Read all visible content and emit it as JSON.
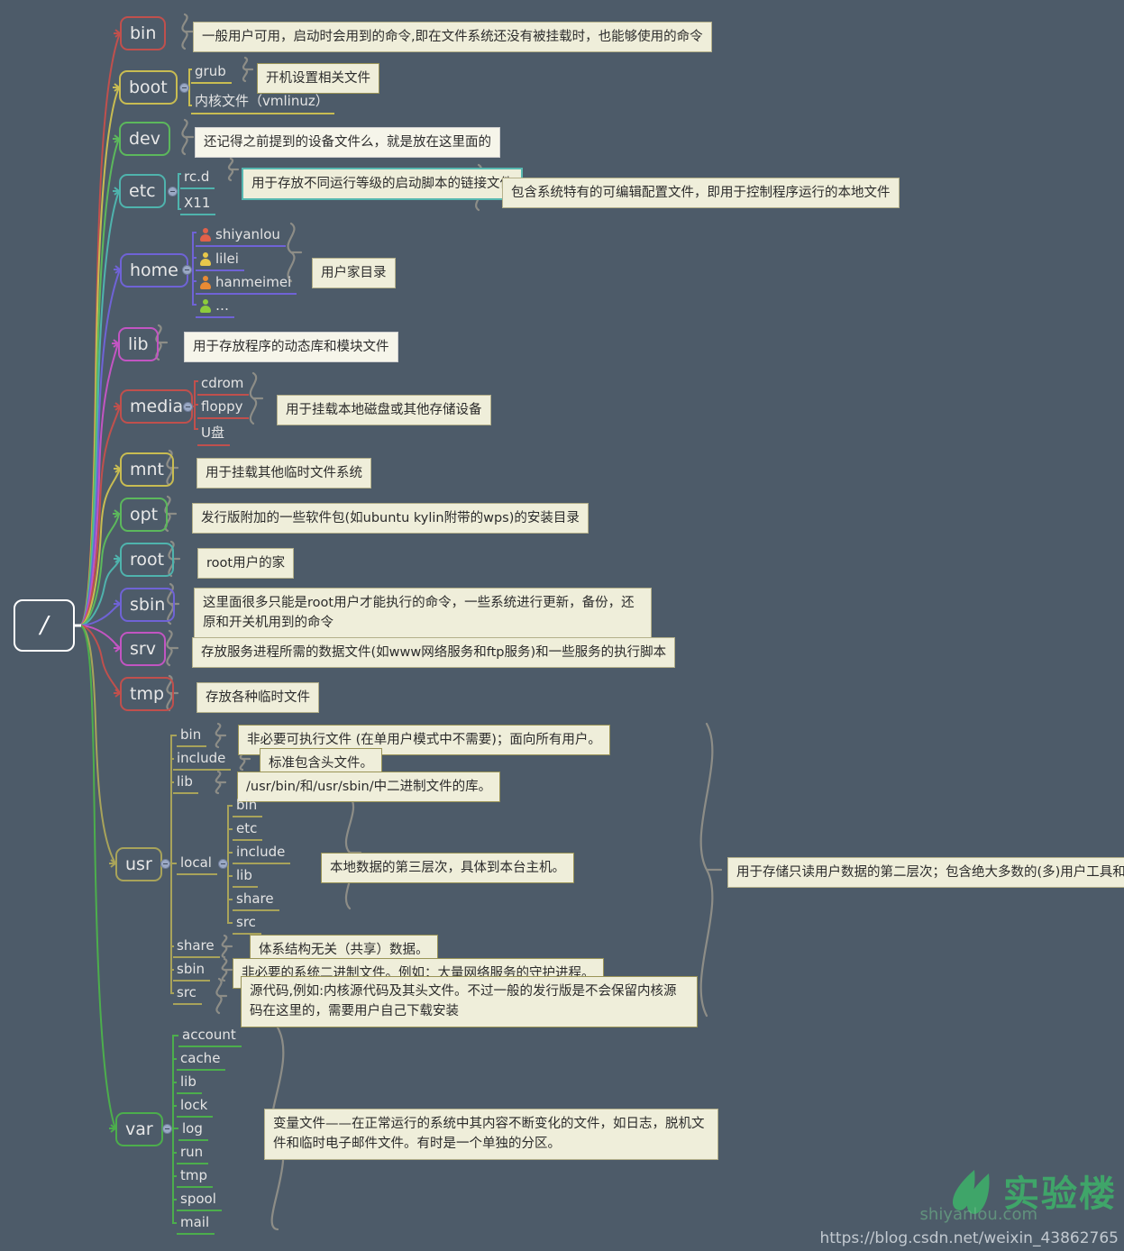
{
  "root": {
    "label": "/"
  },
  "watermark": {
    "brand": "实验楼",
    "sub": "shiyanlou.com",
    "blog_url": "https://blog.csdn.net/weixin_43862765"
  },
  "colors": {
    "background": "#4d5b69",
    "note_bg": "#efeeda",
    "root_border": "#ffffff",
    "bin": "#c0504d",
    "boot": "#c8bc52",
    "dev": "#5cb85c",
    "etc": "#4fb3ad",
    "home": "#6f63d6",
    "lib": "#c255c2",
    "media": "#c0504d",
    "mnt": "#c8bc52",
    "opt": "#5cb85c",
    "root_dir": "#4fb3ad",
    "sbin": "#6f63d6",
    "srv": "#c255c2",
    "tmp": "#c0504d",
    "usr": "#a8a35a",
    "var": "#4cae4c"
  },
  "nodes": [
    {
      "id": "bin",
      "label": "bin",
      "color": "#c0504d",
      "note": "一般用户可用，启动时会用到的命令,即在文件系统还没有被挂载时，也能够使用的命令",
      "children": []
    },
    {
      "id": "boot",
      "label": "boot",
      "color": "#c8bc52",
      "children": [
        {
          "label": "grub",
          "note": "开机设置相关文件"
        },
        {
          "label": "内核文件（vmlinuz）"
        }
      ]
    },
    {
      "id": "dev",
      "label": "dev",
      "color": "#5cb85c",
      "note": "还记得之前提到的设备文件么，就是放在这里面的",
      "children": []
    },
    {
      "id": "etc",
      "label": "etc",
      "color": "#4fb3ad",
      "note": "包含系统特有的可编辑配置文件，即用于控制程序运行的本地文件",
      "children": [
        {
          "label": "rc.d",
          "note": "用于存放不同运行等级的启动脚本的链接文件"
        },
        {
          "label": "X11"
        }
      ]
    },
    {
      "id": "home",
      "label": "home",
      "color": "#6f63d6",
      "note": "用户家目录",
      "children": [
        {
          "label": "shiyanlou",
          "icon": "person-icon",
          "icon_color": "#e1614a"
        },
        {
          "label": "lilei",
          "icon": "person-icon",
          "icon_color": "#e8c84a"
        },
        {
          "label": "hanmeimei",
          "icon": "person-icon",
          "icon_color": "#e88a34"
        },
        {
          "label": "…",
          "icon": "person-icon",
          "icon_color": "#8dcc3c"
        }
      ]
    },
    {
      "id": "lib",
      "label": "lib",
      "color": "#c255c2",
      "note": "用于存放程序的动态库和模块文件",
      "children": []
    },
    {
      "id": "media",
      "label": "media",
      "color": "#c0504d",
      "note": "用于挂载本地磁盘或其他存储设备",
      "children": [
        {
          "label": "cdrom"
        },
        {
          "label": "floppy"
        },
        {
          "label": "U盘"
        }
      ]
    },
    {
      "id": "mnt",
      "label": "mnt",
      "color": "#c8bc52",
      "note": "用于挂载其他临时文件系统",
      "children": []
    },
    {
      "id": "opt",
      "label": "opt",
      "color": "#5cb85c",
      "note": "发行版附加的一些软件包(如ubuntu kylin附带的wps)的安装目录",
      "children": []
    },
    {
      "id": "root",
      "label": "root",
      "color": "#4fb3ad",
      "note": "root用户的家",
      "children": []
    },
    {
      "id": "sbin",
      "label": "sbin",
      "color": "#6f63d6",
      "note": "这里面很多只能是root用户才能执行的命令，一些系统进行更新，备份，还原和开关机用到的命令",
      "children": []
    },
    {
      "id": "srv",
      "label": "srv",
      "color": "#c255c2",
      "note": "存放服务进程所需的数据文件(如www网络服务和ftp服务)和一些服务的执行脚本",
      "children": []
    },
    {
      "id": "tmp",
      "label": "tmp",
      "color": "#c0504d",
      "note": "存放各种临时文件",
      "children": []
    },
    {
      "id": "usr",
      "label": "usr",
      "color": "#a8a35a",
      "note": "用于存储只读用户数据的第二层次；包含绝大多数的(多)用户工具和应用程序",
      "children": [
        {
          "label": "bin",
          "note": "非必要可执行文件 (在单用户模式中不需要)；面向所有用户。"
        },
        {
          "label": "include",
          "note": "标准包含头文件。"
        },
        {
          "label": "lib",
          "note": "/usr/bin/和/usr/sbin/中二进制文件的库。"
        },
        {
          "label": "local",
          "note": "本地数据的第三层次，具体到本台主机。",
          "children": [
            {
              "label": "bin"
            },
            {
              "label": "etc"
            },
            {
              "label": "include"
            },
            {
              "label": "lib"
            },
            {
              "label": "share"
            },
            {
              "label": "src"
            }
          ]
        },
        {
          "label": "share",
          "note": "体系结构无关（共享）数据。"
        },
        {
          "label": "sbin",
          "note": "非必要的系统二进制文件。例如：大量网络服务的守护进程。"
        },
        {
          "label": "src",
          "note": "源代码,例如:内核源代码及其头文件。不过一般的发行版是不会保留内核源码在这里的，需要用户自己下载安装"
        }
      ]
    },
    {
      "id": "var",
      "label": "var",
      "color": "#4cae4c",
      "note": "变量文件——在正常运行的系统中其内容不断变化的文件，如日志，脱机文件和临时电子邮件文件。有时是一个单独的分区。",
      "children": [
        {
          "label": "account"
        },
        {
          "label": "cache"
        },
        {
          "label": "lib"
        },
        {
          "label": "lock"
        },
        {
          "label": "log"
        },
        {
          "label": "run"
        },
        {
          "label": "tmp"
        },
        {
          "label": "spool"
        },
        {
          "label": "mail"
        }
      ]
    }
  ]
}
